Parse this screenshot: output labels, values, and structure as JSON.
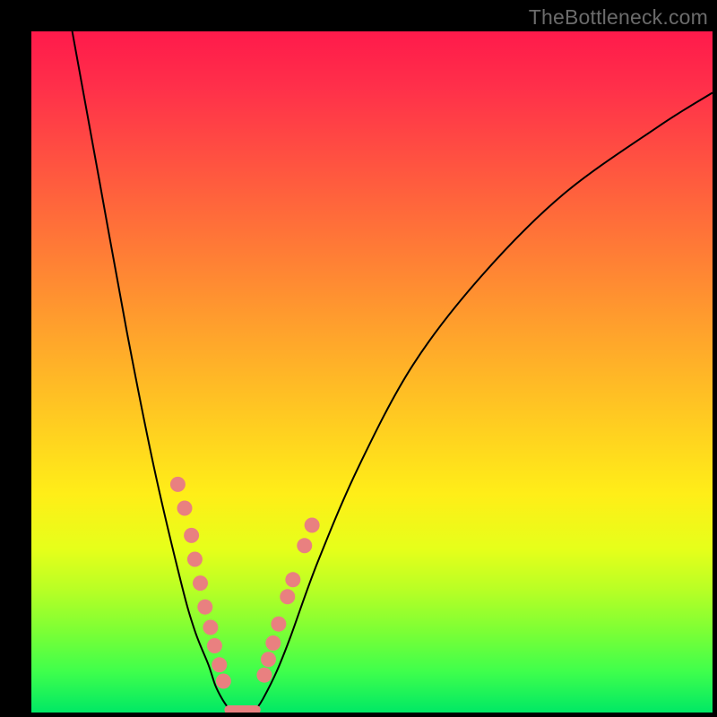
{
  "watermark": "TheBottleneck.com",
  "chart_data": {
    "type": "line",
    "title": "",
    "xlabel": "",
    "ylabel": "",
    "xlim": [
      0,
      100
    ],
    "ylim": [
      0,
      100
    ],
    "grid": false,
    "legend": false,
    "series": [
      {
        "name": "left-curve",
        "x": [
          6,
          10,
          14,
          18,
          22,
          24,
          26,
          27,
          28,
          29
        ],
        "y": [
          100,
          78,
          56,
          36,
          19,
          12,
          7,
          4,
          2,
          0.5
        ]
      },
      {
        "name": "right-curve",
        "x": [
          33,
          34,
          36,
          38,
          42,
          48,
          56,
          66,
          78,
          92,
          100
        ],
        "y": [
          0.5,
          2,
          6,
          11,
          22,
          36,
          51,
          64,
          76,
          86,
          91
        ]
      },
      {
        "name": "floor-segment",
        "x": [
          29,
          33
        ],
        "y": [
          0.4,
          0.4
        ]
      }
    ],
    "scatter": [
      {
        "name": "left-dots",
        "color": "#e98080",
        "points": [
          {
            "x": 21.5,
            "y": 33.5
          },
          {
            "x": 22.5,
            "y": 30.0
          },
          {
            "x": 23.5,
            "y": 26.0
          },
          {
            "x": 24.0,
            "y": 22.5
          },
          {
            "x": 24.8,
            "y": 19.0
          },
          {
            "x": 25.5,
            "y": 15.5
          },
          {
            "x": 26.3,
            "y": 12.5
          },
          {
            "x": 26.9,
            "y": 9.8
          },
          {
            "x": 27.6,
            "y": 7.0
          },
          {
            "x": 28.2,
            "y": 4.6
          }
        ]
      },
      {
        "name": "right-dots",
        "color": "#e98080",
        "points": [
          {
            "x": 34.2,
            "y": 5.5
          },
          {
            "x": 34.8,
            "y": 7.8
          },
          {
            "x": 35.5,
            "y": 10.2
          },
          {
            "x": 36.3,
            "y": 13.0
          },
          {
            "x": 37.6,
            "y": 17.0
          },
          {
            "x": 38.4,
            "y": 19.5
          },
          {
            "x": 40.1,
            "y": 24.5
          },
          {
            "x": 41.2,
            "y": 27.5
          }
        ]
      }
    ]
  }
}
